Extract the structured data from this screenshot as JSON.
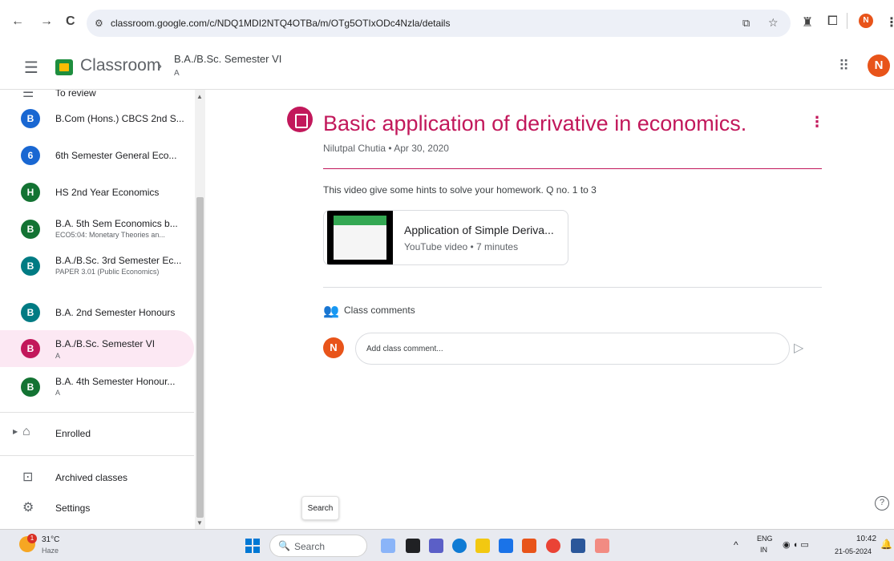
{
  "browser": {
    "back_glyph": "←",
    "forward_glyph": "→",
    "reload_glyph": "C",
    "url": "classroom.google.com/c/NDQ1MDI2NTQ4OTBa/m/OTg5OTIxODc4Nzla/details",
    "profile_initial": "N"
  },
  "header": {
    "app_title": "Classroom",
    "breadcrumb_separator": "›",
    "class_title": "B.A./B.Sc. Semester VI",
    "class_section": "A",
    "profile_initial": "N"
  },
  "sidebar": {
    "to_review_label": "To review",
    "classes": [
      {
        "initial": "B",
        "title": "B.Com (Hons.) CBCS 2nd S...",
        "subtitle": "",
        "color": "#1967d2"
      },
      {
        "initial": "6",
        "title": "6th Semester General Eco...",
        "subtitle": "",
        "color": "#1967d2"
      },
      {
        "initial": "H",
        "title": "HS 2nd Year Economics",
        "subtitle": "",
        "color": "#137333"
      },
      {
        "initial": "B",
        "title": "B.A. 5th Sem Economics b...",
        "subtitle": "ECO5:04: Monetary Theories an...",
        "color": "#137333"
      },
      {
        "initial": "B",
        "title": "B.A./B.Sc. 3rd Semester Ec...",
        "subtitle": "PAPER 3.01 (Public Economics)",
        "color": "#007b83"
      },
      {
        "initial": "B",
        "title": "B.A. 2nd Semester Honours",
        "subtitle": "",
        "color": "#007b83"
      },
      {
        "initial": "B",
        "title": "B.A./B.Sc. Semester VI",
        "subtitle": "A",
        "color": "#c2185b"
      },
      {
        "initial": "B",
        "title": "B.A. 4th Semester Honour...",
        "subtitle": "A",
        "color": "#137333"
      }
    ],
    "enrolled_label": "Enrolled",
    "archived_label": "Archived classes",
    "settings_label": "Settings"
  },
  "post": {
    "title": "Basic application of derivative in economics.",
    "author_date": "Nilutpal Chutia • Apr 30, 2020",
    "description": "This video give some hints to solve your homework. Q no. 1 to 3",
    "attachment": {
      "title": "Application of Simple Deriva...",
      "subtitle": "YouTube video • 7 minutes"
    },
    "comments_label": "Class comments",
    "comment_avatar_initial": "N",
    "comment_placeholder": "Add class comment...",
    "accent_color": "#c2185b"
  },
  "tooltip": "Search",
  "help_glyph": "?",
  "taskbar": {
    "weather_temp": "31°C",
    "weather_desc": "Haze",
    "weather_badge": "1",
    "search_label": "Search",
    "lang_line1": "ENG",
    "lang_line2": "IN",
    "time": "10:42",
    "date": "21-05-2024"
  }
}
